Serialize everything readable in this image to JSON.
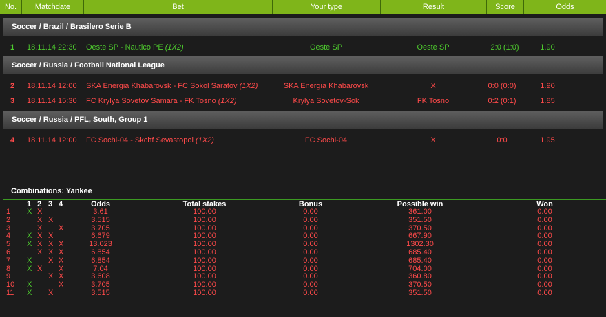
{
  "header": {
    "columns": [
      "No.",
      "Matchdate",
      "Bet",
      "Your type",
      "Result",
      "Score",
      "Odds"
    ]
  },
  "groups": [
    {
      "title": "Soccer / Brazil / Brasilero Serie B",
      "rows": [
        {
          "no": "1",
          "date": "18.11.14 22:30",
          "bet": "Oeste SP - Nautico PE",
          "tag": "(1X2)",
          "type": "Oeste SP",
          "result": "Oeste SP",
          "score": "2:0 (1:0)",
          "odds": "1.90",
          "status": "green"
        }
      ]
    },
    {
      "title": "Soccer / Russia / Football National League",
      "rows": [
        {
          "no": "2",
          "date": "18.11.14 12:00",
          "bet": "SKA Energia Khabarovsk - FC Sokol Saratov",
          "tag": "(1X2)",
          "type": "SKA Energia Khabarovsk",
          "result": "X",
          "score": "0:0 (0:0)",
          "odds": "1.90",
          "status": "red"
        },
        {
          "no": "3",
          "date": "18.11.14 15:30",
          "bet": "FC Krylya Sovetov Samara - FK Tosno",
          "tag": "(1X2)",
          "type": "Krylya Sovetov-Sok",
          "result": "FK Tosno",
          "score": "0:2 (0:1)",
          "odds": "1.85",
          "status": "red"
        }
      ]
    },
    {
      "title": "Soccer / Russia / PFL, South, Group 1",
      "rows": [
        {
          "no": "4",
          "date": "18.11.14 12:00",
          "bet": "FC Sochi-04 - Skchf Sevastopol",
          "tag": "(1X2)",
          "type": "FC Sochi-04",
          "result": "X",
          "score": "0:0",
          "odds": "1.95",
          "status": "red"
        }
      ]
    }
  ],
  "combinations": {
    "title": "Combinations: Yankee",
    "headers": {
      "m1": "1",
      "m2": "2",
      "m3": "3",
      "m4": "4",
      "odds": "Odds",
      "stakes": "Total stakes",
      "bonus": "Bonus",
      "win": "Possible win",
      "won": "Won"
    },
    "rows": [
      {
        "no": "1",
        "m": [
          1,
          1,
          0,
          0
        ],
        "odds": "3.61",
        "stakes": "100.00",
        "bonus": "0.00",
        "win": "361.00",
        "won": "0.00"
      },
      {
        "no": "2",
        "m": [
          0,
          1,
          1,
          0
        ],
        "odds": "3.515",
        "stakes": "100.00",
        "bonus": "0.00",
        "win": "351.50",
        "won": "0.00"
      },
      {
        "no": "3",
        "m": [
          0,
          1,
          0,
          1
        ],
        "odds": "3.705",
        "stakes": "100.00",
        "bonus": "0.00",
        "win": "370.50",
        "won": "0.00"
      },
      {
        "no": "4",
        "m": [
          1,
          1,
          1,
          0
        ],
        "odds": "6.679",
        "stakes": "100.00",
        "bonus": "0.00",
        "win": "667.90",
        "won": "0.00"
      },
      {
        "no": "5",
        "m": [
          1,
          1,
          1,
          1
        ],
        "odds": "13.023",
        "stakes": "100.00",
        "bonus": "0.00",
        "win": "1302.30",
        "won": "0.00"
      },
      {
        "no": "6",
        "m": [
          0,
          1,
          1,
          1
        ],
        "odds": "6.854",
        "stakes": "100.00",
        "bonus": "0.00",
        "win": "685.40",
        "won": "0.00"
      },
      {
        "no": "7",
        "m": [
          1,
          0,
          1,
          1
        ],
        "odds": "6.854",
        "stakes": "100.00",
        "bonus": "0.00",
        "win": "685.40",
        "won": "0.00"
      },
      {
        "no": "8",
        "m": [
          1,
          1,
          0,
          1
        ],
        "odds": "7.04",
        "stakes": "100.00",
        "bonus": "0.00",
        "win": "704.00",
        "won": "0.00"
      },
      {
        "no": "9",
        "m": [
          0,
          0,
          1,
          1
        ],
        "odds": "3.608",
        "stakes": "100.00",
        "bonus": "0.00",
        "win": "360.80",
        "won": "0.00"
      },
      {
        "no": "10",
        "m": [
          1,
          0,
          0,
          1
        ],
        "odds": "3.705",
        "stakes": "100.00",
        "bonus": "0.00",
        "win": "370.50",
        "won": "0.00"
      },
      {
        "no": "11",
        "m": [
          1,
          0,
          1,
          0
        ],
        "odds": "3.515",
        "stakes": "100.00",
        "bonus": "0.00",
        "win": "351.50",
        "won": "0.00"
      }
    ],
    "marker": "X"
  },
  "colors": {
    "header_green": "#7fb51a",
    "won_green": "#4ecb2e",
    "lost_red": "#ff4a4a",
    "background": "#1c1c1c"
  }
}
